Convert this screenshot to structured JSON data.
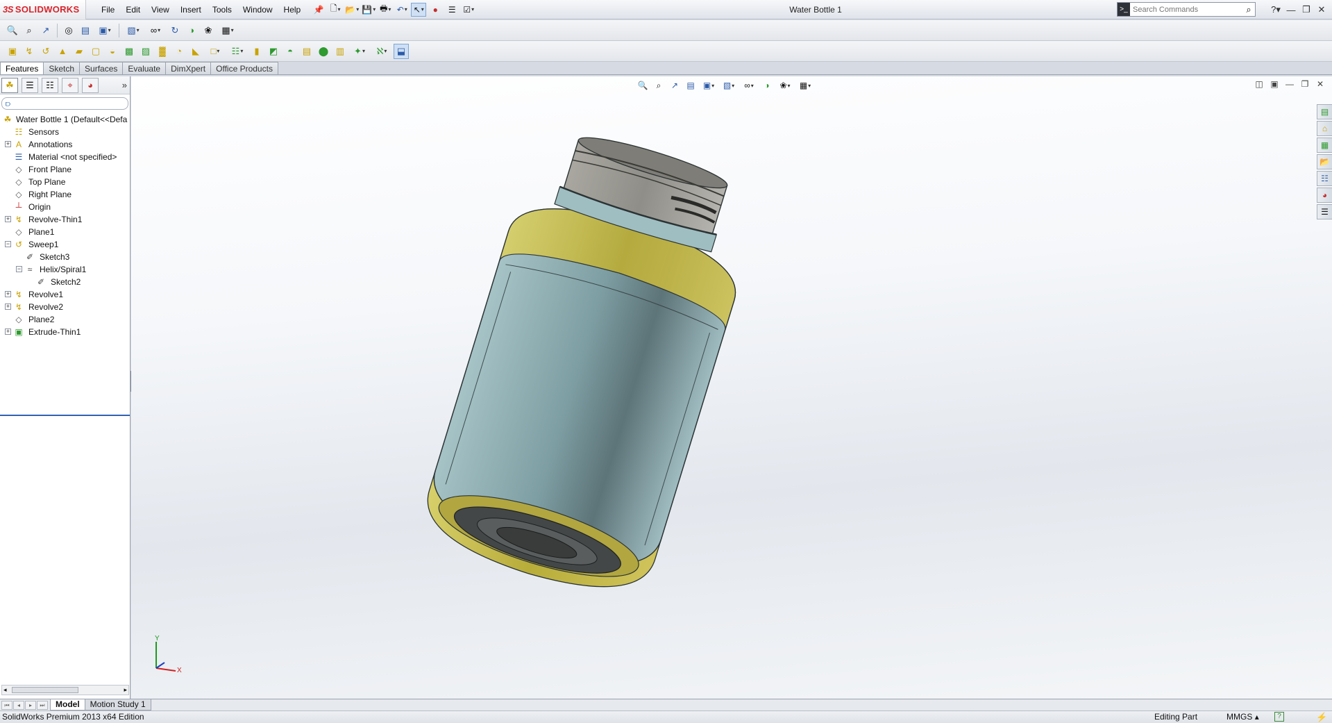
{
  "app": {
    "logo_ds": "3S",
    "logo_name": "SOLIDWORKS",
    "document_title": "Water Bottle 1"
  },
  "menu": [
    "File",
    "Edit",
    "View",
    "Insert",
    "Tools",
    "Window",
    "Help"
  ],
  "search": {
    "placeholder": "Search Commands"
  },
  "command_tabs": [
    "Features",
    "Sketch",
    "Surfaces",
    "Evaluate",
    "DimXpert",
    "Office Products"
  ],
  "feature_tree": {
    "root": "Water Bottle 1  (Default<<Defa",
    "items": [
      {
        "label": "Sensors",
        "icon": "sensor-icon",
        "level": 1,
        "expander": ""
      },
      {
        "label": "Annotations",
        "icon": "annotation-icon",
        "level": 1,
        "expander": "+"
      },
      {
        "label": "Material <not specified>",
        "icon": "material-icon",
        "level": 1,
        "expander": ""
      },
      {
        "label": "Front Plane",
        "icon": "plane-icon",
        "level": 1,
        "expander": ""
      },
      {
        "label": "Top Plane",
        "icon": "plane-icon",
        "level": 1,
        "expander": ""
      },
      {
        "label": "Right Plane",
        "icon": "plane-icon",
        "level": 1,
        "expander": ""
      },
      {
        "label": "Origin",
        "icon": "origin-icon",
        "level": 1,
        "expander": ""
      },
      {
        "label": "Revolve-Thin1",
        "icon": "revolve-icon",
        "level": 1,
        "expander": "+"
      },
      {
        "label": "Plane1",
        "icon": "plane-icon",
        "level": 1,
        "expander": ""
      },
      {
        "label": "Sweep1",
        "icon": "sweep-icon",
        "level": 1,
        "expander": "-"
      },
      {
        "label": "Sketch3",
        "icon": "sketch-icon",
        "level": 2,
        "expander": ""
      },
      {
        "label": "Helix/Spiral1",
        "icon": "helix-icon",
        "level": 2,
        "expander": "-"
      },
      {
        "label": "Sketch2",
        "icon": "sketch-icon",
        "level": 3,
        "expander": ""
      },
      {
        "label": "Revolve1",
        "icon": "revolve-icon",
        "level": 1,
        "expander": "+"
      },
      {
        "label": "Revolve2",
        "icon": "revolve-icon",
        "level": 1,
        "expander": "+"
      },
      {
        "label": "Plane2",
        "icon": "plane-icon",
        "level": 1,
        "expander": ""
      },
      {
        "label": "Extrude-Thin1",
        "icon": "extrude-icon",
        "level": 1,
        "expander": "+"
      }
    ]
  },
  "triad": {
    "x": "X",
    "y": "Y"
  },
  "bottom_tabs": [
    "Model",
    "Motion Study 1"
  ],
  "status": {
    "edition": "SolidWorks Premium 2013 x64 Edition",
    "mode": "Editing Part",
    "units": "MMGS",
    "units_arrow": "▴",
    "help": "?"
  },
  "colors": {
    "bottle_body": "#7d9ea3",
    "bottle_band": "#b8ac3a",
    "cap": "#8f8e88"
  }
}
